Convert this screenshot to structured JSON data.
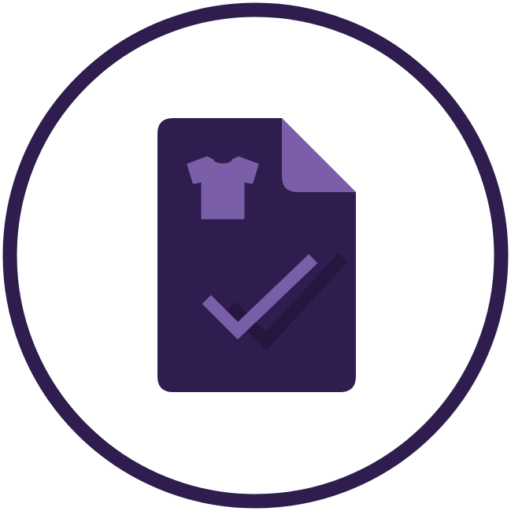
{
  "icon": {
    "name": "clothing-document-approved-icon",
    "parts": [
      "circle-outline",
      "document-icon",
      "tshirt-icon",
      "checkmark-icon"
    ],
    "colors": {
      "ring": "#2e1d4e",
      "document": "#2e1d4e",
      "accent": "#7b5ea8",
      "background": "#ffffff"
    }
  }
}
